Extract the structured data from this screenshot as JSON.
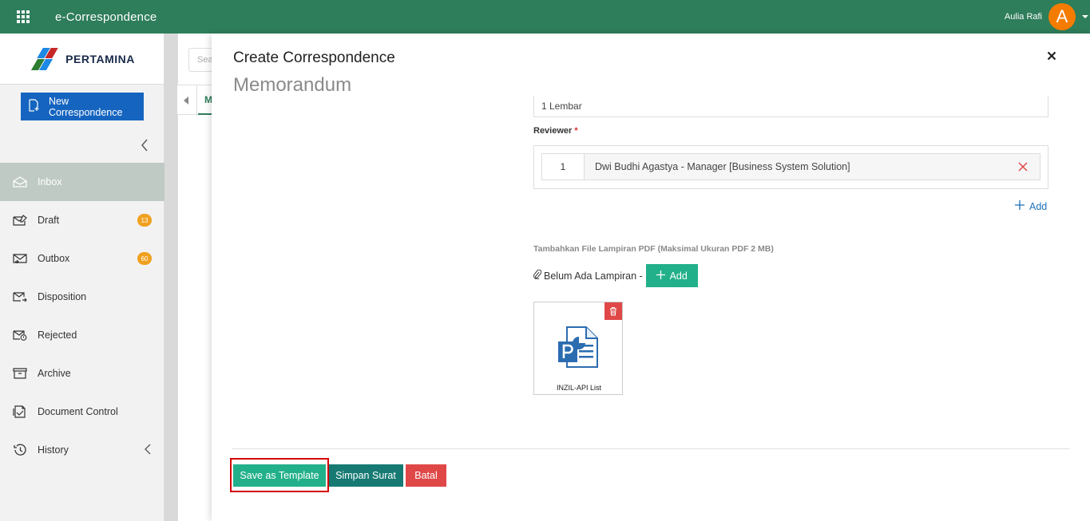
{
  "topbar": {
    "app_title": "e-Correspondence",
    "user_name": "Aulia Rafi",
    "avatar_initial": "A",
    "color": "#2e7d5b",
    "avatar_color": "#f57c00"
  },
  "sidebar": {
    "logo_text": "PERTAMINA",
    "new_button": "New Correspondence",
    "items": [
      {
        "label": "Inbox",
        "icon": "inbox-icon",
        "badge": ""
      },
      {
        "label": "Draft",
        "icon": "draft-icon",
        "badge": "13"
      },
      {
        "label": "Outbox",
        "icon": "outbox-icon",
        "badge": "60"
      },
      {
        "label": "Disposition",
        "icon": "disposition-icon",
        "badge": ""
      },
      {
        "label": "Rejected",
        "icon": "rejected-icon",
        "badge": ""
      },
      {
        "label": "Archive",
        "icon": "archive-icon",
        "badge": ""
      },
      {
        "label": "Document Control",
        "icon": "document-control-icon",
        "badge": ""
      },
      {
        "label": "History",
        "icon": "history-icon",
        "badge": ""
      }
    ]
  },
  "background": {
    "search_placeholder": "Search",
    "tab_label": "M"
  },
  "panel": {
    "title": "Create Correspondence",
    "subtitle": "Memorandum",
    "attachment_count_value": "1 Lembar",
    "reviewer_label": "Reviewer",
    "required_mark": "*",
    "reviewers": [
      {
        "number": "1",
        "name": "Dwi Budhi Agastya - Manager [Business System Solution]"
      }
    ],
    "add_reviewer_label": "Add",
    "attach_label": "Tambahkan File Lampiran PDF (Maksimal Ukuran PDF 2 MB)",
    "attach_status": "Belum Ada Lampiran -",
    "attach_add_label": "Add",
    "file_name": "INZIL-API List",
    "buttons": {
      "save_template": "Save as Template",
      "simpan": "Simpan Surat",
      "batal": "Batal"
    },
    "colors": {
      "primary_green": "#22b08a",
      "teal": "#167a73",
      "danger": "#e04848",
      "link_blue": "#1e6fb8"
    }
  }
}
